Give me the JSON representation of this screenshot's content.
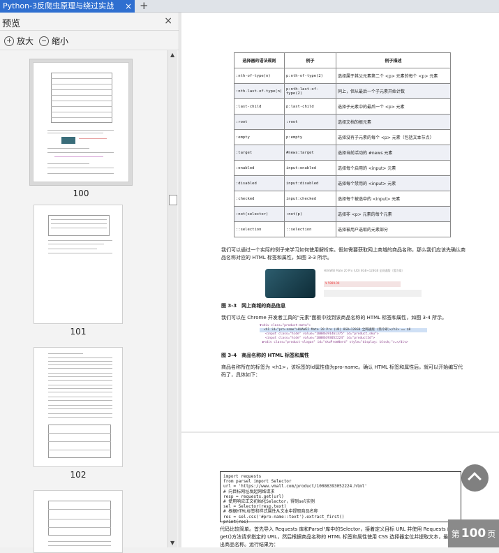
{
  "window": {
    "tab_title": "Python-3反爬虫原理与绕过实战",
    "tab_close": "×",
    "new_tab": "+"
  },
  "sidebar": {
    "title": "预览",
    "close": "×",
    "zoom_in": "放大",
    "zoom_out": "缩小",
    "thumbnails": [
      {
        "label": "100",
        "selected": true
      },
      {
        "label": "101",
        "selected": false
      },
      {
        "label": "102",
        "selected": false
      },
      {
        "label": "",
        "selected": false
      }
    ]
  },
  "document": {
    "table": {
      "headers": [
        "选择器的语法规则",
        "例子",
        "例子描述"
      ],
      "rows": [
        [
          ":nth-of-type(n)",
          "p:nth-of-type(2)",
          "选择属于其父元素第二个 <p> 元素的每个 <p> 元素"
        ],
        [
          ":nth-last-of-type(n)",
          "p:nth-last-of-type(2)",
          "同上，但从最后一个子元素开始计数"
        ],
        [
          ":last-child",
          "p:last-child",
          "选择子元素中的最后一个 <p> 元素"
        ],
        [
          ":root",
          ":root",
          "选择文档的根元素"
        ],
        [
          ":empty",
          "p:empty",
          "选择没有子元素的每个 <p> 元素（包括文本节点）"
        ],
        [
          ":target",
          "#news:target",
          "选择当前活动的 #news 元素"
        ],
        [
          ":enabled",
          "input:enabled",
          "选择每个启用的 <input> 元素"
        ],
        [
          ":disabled",
          "input:disabled",
          "选择每个禁用的 <input> 元素"
        ],
        [
          ":checked",
          "input:checked",
          "选择每个被选中的 <input> 元素"
        ],
        [
          ":not(selector)",
          ":not(p)",
          "选择非 <p> 元素的每个元素"
        ],
        [
          "::selection",
          "::selection",
          "选择被用户选取的元素部分"
        ]
      ]
    },
    "para1": "我们可以通过一个实际的例子来学习如何使用解析库。假如需要获取网上商城的商品名称，那么我们应该先确认商品名称对应的 HTML 标签和属性，如图 3-3 所示。",
    "product_title": "HUAWEI Mate 20 Pro (UD) 8GB+128GB 全网通版（翡冷翠）",
    "product_price": "¥ 5999.00",
    "fig3_3": "图 3-3　网上商城的商品信息",
    "para2": "我们可以在 Chrome 开发者工具的\"元素\"面板中找到该商品名称的 HTML 标签和属性，如图 3-4 所示。",
    "devtools": [
      "▼<div class=\"product-meta\">",
      "<h1 id=\"pro-name\">HUAWEI Mate 20 Pro (UD) 8GB+128GB 全网通版 (翡冷翠)</h1> == $0",
      "<input class=\"hide\" value=\"10086391461375\" id=\"product_sku\">",
      "<input class=\"hide\" value=\"10086393052224\" id=\"productId\">",
      "▶<div class=\"product-slogan\" id=\"skuPromWord\" style=\"display: block;\">…</div>"
    ],
    "fig3_4": "图 3-4　商品名称的 HTML 标签和属性",
    "para3": "商品名称所在的标签为 <h1>，该标签的id属性值为pro-name。确认 HTML 标签和属性后，就可以开始编写代码了，具体如下：",
    "code": "import requests\nfrom parsel import Selector\nurl = 'https://www.vmall.com/product/10086393052224.html'\n# 向目标网址发起网络请求\nresp = requests.get(url)\n# 使用响应正文初始化Selector，得到sel实例\nsel = Selector(resp.text)\n# 根据HTML标签和样式属性从文本中提取商品名称\nres = sel.css('#pro-name::text').extract_first()\nprint(res)",
    "para4": "代码比较简单。首先导入 Requests 库和Parsel¹库中的Selector，接着定义目标 URL 并使用 Requests 的get()方法请求指定的 URL，然后根据商品名称的 HTML 标签和属性使用 CSS 选择器定位并提取文本，最后输出商品名称。运行结果为："
  },
  "page_indicator": {
    "prefix": "第",
    "number": "100",
    "suffix": "页"
  },
  "colors": {
    "tab_active": "#2f6fd0",
    "page_bg": "#ffffff",
    "viewer_bg": "#e7e7e7"
  }
}
